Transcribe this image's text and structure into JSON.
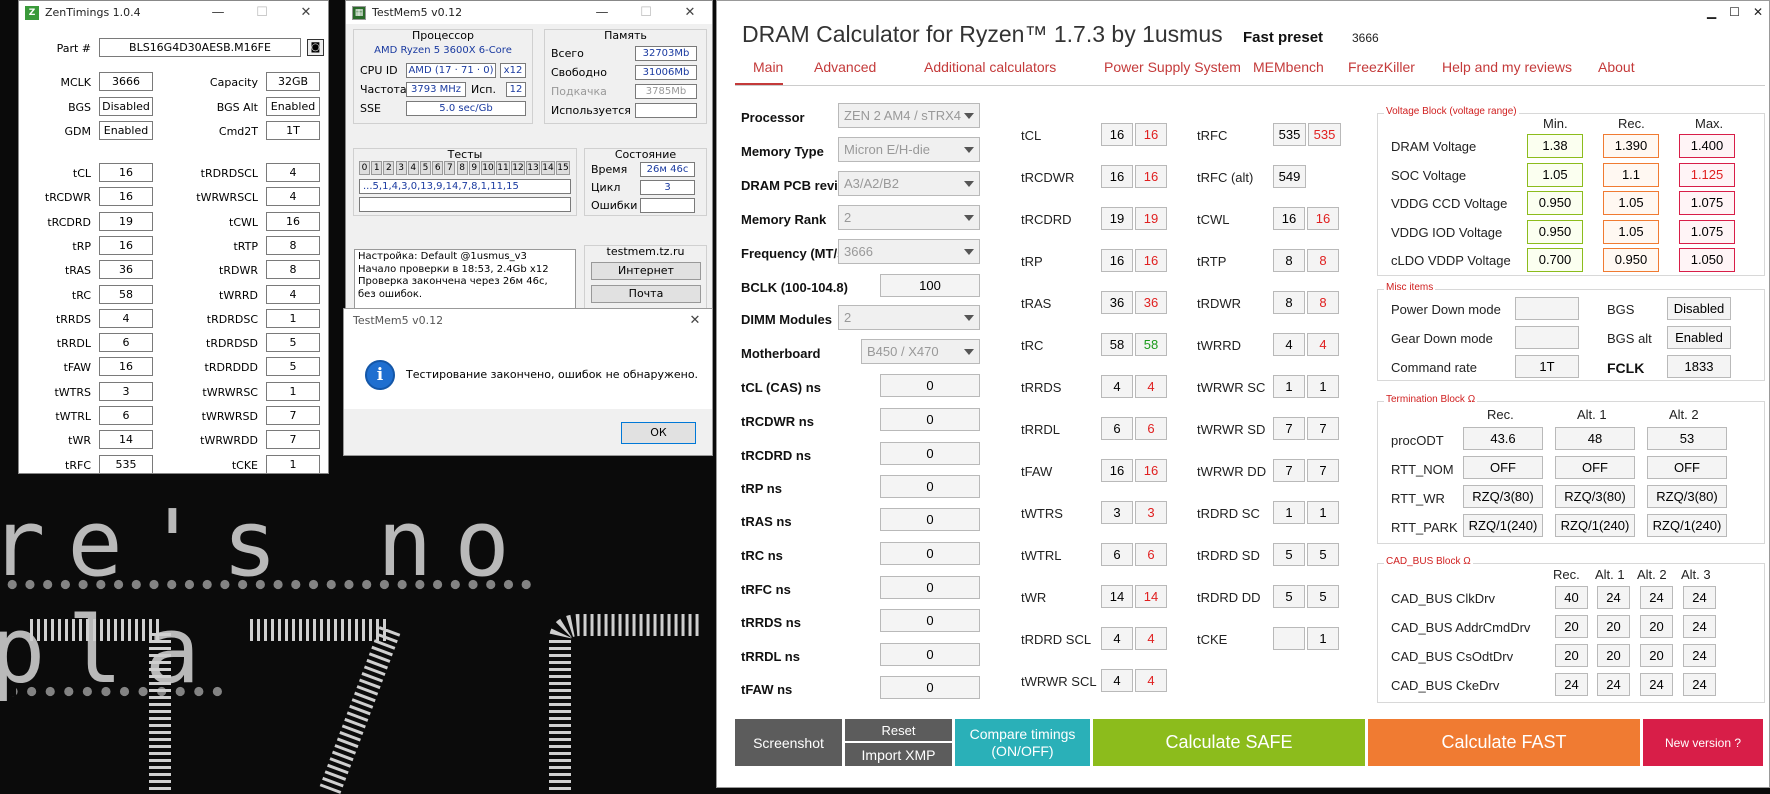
{
  "zen": {
    "title": "ZenTimings 1.0.4",
    "part_label": "Part #",
    "part_value": "BLS16G4D30AESB.M16FE",
    "rows": [
      {
        "l1": "MCLK",
        "v1": "3666",
        "l2": "Capacity",
        "v2": "32GB"
      },
      {
        "l1": "BGS",
        "v1": "Disabled",
        "l2": "BGS Alt",
        "v2": "Enabled"
      },
      {
        "l1": "GDM",
        "v1": "Enabled",
        "l2": "Cmd2T",
        "v2": "1T"
      },
      {
        "l1": "tCL",
        "v1": "16",
        "l2": "tRDRDSCL",
        "v2": "4"
      },
      {
        "l1": "tRCDWR",
        "v1": "16",
        "l2": "tWRWRSCL",
        "v2": "4"
      },
      {
        "l1": "tRCDRD",
        "v1": "19",
        "l2": "tCWL",
        "v2": "16"
      },
      {
        "l1": "tRP",
        "v1": "16",
        "l2": "tRTP",
        "v2": "8"
      },
      {
        "l1": "tRAS",
        "v1": "36",
        "l2": "tRDWR",
        "v2": "8"
      },
      {
        "l1": "tRC",
        "v1": "58",
        "l2": "tWRRD",
        "v2": "4"
      },
      {
        "l1": "tRRDS",
        "v1": "4",
        "l2": "tRDRDSC",
        "v2": "1"
      },
      {
        "l1": "tRRDL",
        "v1": "6",
        "l2": "tRDRDSD",
        "v2": "5"
      },
      {
        "l1": "tFAW",
        "v1": "16",
        "l2": "tRDRDDD",
        "v2": "5"
      },
      {
        "l1": "tWTRS",
        "v1": "3",
        "l2": "tWRWRSC",
        "v2": "1"
      },
      {
        "l1": "tWTRL",
        "v1": "6",
        "l2": "tWRWRSD",
        "v2": "7"
      },
      {
        "l1": "tWR",
        "v1": "14",
        "l2": "tWRWRDD",
        "v2": "7"
      },
      {
        "l1": "tRFC",
        "v1": "535",
        "l2": "tCKE",
        "v2": "1"
      }
    ]
  },
  "tm": {
    "title": "TestMem5 v0.12",
    "cpu_group": "Процессор",
    "cpu_name": "AMD Ryzen 5 3600X 6-Core",
    "cpu_id_label": "CPU ID",
    "cpu_id_value": "AMD  (17 · 71 · 0)",
    "cpu_threads": "x12",
    "freq_label": "Частота",
    "freq_value": "3793 MHz",
    "used_label": "Исп.",
    "used_value": "12",
    "sse_label": "SSE",
    "sse_value": "5.0 sec/Gb",
    "mem_group": "Память",
    "total_label": "Всего",
    "total_value": "32703Mb",
    "free_label": "Свободно",
    "free_value": "31006Mb",
    "swap_label": "Подкачка",
    "swap_value": "3785Mb",
    "inuse_label": "Используется",
    "tests_group": "Тесты",
    "test_cells": [
      "0",
      "1",
      "2",
      "3",
      "4",
      "5",
      "6",
      "7",
      "8",
      "9",
      "10",
      "11",
      "12",
      "13",
      "14",
      "15"
    ],
    "test_seq": "...5,1,4,3,0,13,9,14,7,8,1,11,15",
    "state_group": "Состояние",
    "time_label": "Время",
    "time_value": "26м 46с",
    "cycle_label": "Цикл",
    "cycle_value": "3",
    "err_label": "Ошибки",
    "log": [
      "Настройка: Default @1usmus_v3",
      "Начало проверки в 18:53, 2.4Gb x12",
      "Проверка закончена через 26м 46с,",
      "без ошибок."
    ],
    "site": "testmem.tz.ru",
    "btn_internet": "Интернет",
    "btn_mail": "Почта"
  },
  "dialog": {
    "title": "TestMem5 v0.12",
    "message": "Тестирование закончено, ошибок не обнаружено.",
    "ok": "ОК"
  },
  "bg_text": "re's no pla",
  "dc": {
    "title": "DRAM Calculator for Ryzen™ 1.7.3 by 1usmus",
    "preset_label": "Fast preset",
    "preset_value": "3666",
    "tabs": [
      "Main",
      "Advanced",
      "Additional calculators",
      "Power Supply System",
      "MEMbench",
      "FreezKiller",
      "Help and my reviews",
      "About"
    ],
    "left": [
      {
        "label": "Processor",
        "value": "ZEN 2 AM4 / sTRX4",
        "type": "select"
      },
      {
        "label": "Memory Type",
        "value": "Micron E/H-die",
        "type": "select"
      },
      {
        "label": "DRAM PCB revision",
        "value": "A3/A2/B2",
        "type": "select"
      },
      {
        "label": "Memory Rank",
        "value": "2",
        "type": "select"
      },
      {
        "label": "Frequency (MT/s)",
        "value": "3666",
        "type": "select"
      },
      {
        "label": "BCLK (100-104.8)",
        "value": "100",
        "type": "input"
      },
      {
        "label": "DIMM Modules",
        "value": "2",
        "type": "select"
      },
      {
        "label": "Motherboard",
        "value": "B450 / X470",
        "type": "select"
      },
      {
        "label": "tCL (CAS) ns",
        "value": "0",
        "type": "input"
      },
      {
        "label": "tRCDWR ns",
        "value": "0",
        "type": "input"
      },
      {
        "label": "tRCDRD ns",
        "value": "0",
        "type": "input"
      },
      {
        "label": "tRP ns",
        "value": "0",
        "type": "input"
      },
      {
        "label": "tRAS ns",
        "value": "0",
        "type": "input"
      },
      {
        "label": "tRC ns",
        "value": "0",
        "type": "input"
      },
      {
        "label": "tRFC ns",
        "value": "0",
        "type": "input"
      },
      {
        "label": "tRRDS ns",
        "value": "0",
        "type": "input"
      },
      {
        "label": "tRRDL ns",
        "value": "0",
        "type": "input"
      },
      {
        "label": "tFAW ns",
        "value": "0",
        "type": "input"
      }
    ],
    "mid": [
      {
        "l": "tCL",
        "a": "16",
        "b": "16",
        "c": "red"
      },
      {
        "l": "tRCDWR",
        "a": "16",
        "b": "16",
        "c": "red"
      },
      {
        "l": "tRCDRD",
        "a": "19",
        "b": "19",
        "c": "red"
      },
      {
        "l": "tRP",
        "a": "16",
        "b": "16",
        "c": "red"
      },
      {
        "l": "tRAS",
        "a": "36",
        "b": "36",
        "c": "red"
      },
      {
        "l": "tRC",
        "a": "58",
        "b": "58",
        "c": "green"
      },
      {
        "l": "tRRDS",
        "a": "4",
        "b": "4",
        "c": "red"
      },
      {
        "l": "tRRDL",
        "a": "6",
        "b": "6",
        "c": "red"
      },
      {
        "l": "tFAW",
        "a": "16",
        "b": "16",
        "c": "red"
      },
      {
        "l": "tWTRS",
        "a": "3",
        "b": "3",
        "c": "red"
      },
      {
        "l": "tWTRL",
        "a": "6",
        "b": "6",
        "c": "red"
      },
      {
        "l": "tWR",
        "a": "14",
        "b": "14",
        "c": "red"
      },
      {
        "l": "tRDRD SCL",
        "a": "4",
        "b": "4",
        "c": "red"
      },
      {
        "l": "tWRWR SCL",
        "a": "4",
        "b": "4",
        "c": "red"
      }
    ],
    "right": [
      {
        "l": "tRFC",
        "a": "535",
        "b": "535",
        "c": "red"
      },
      {
        "l": "tRFC (alt)",
        "a": "549",
        "b": "",
        "c": ""
      },
      {
        "l": "tCWL",
        "a": "16",
        "b": "16",
        "c": "red"
      },
      {
        "l": "tRTP",
        "a": "8",
        "b": "8",
        "c": "red"
      },
      {
        "l": "tRDWR",
        "a": "8",
        "b": "8",
        "c": "red"
      },
      {
        "l": "tWRRD",
        "a": "4",
        "b": "4",
        "c": "red"
      },
      {
        "l": "tWRWR SC",
        "a": "1",
        "b": "1",
        "c": ""
      },
      {
        "l": "tWRWR SD",
        "a": "7",
        "b": "7",
        "c": ""
      },
      {
        "l": "tWRWR DD",
        "a": "7",
        "b": "7",
        "c": ""
      },
      {
        "l": "tRDRD SC",
        "a": "1",
        "b": "1",
        "c": ""
      },
      {
        "l": "tRDRD SD",
        "a": "5",
        "b": "5",
        "c": ""
      },
      {
        "l": "tRDRD DD",
        "a": "5",
        "b": "5",
        "c": ""
      },
      {
        "l": "tCKE",
        "a": "",
        "b": "1",
        "c": ""
      }
    ],
    "volt": {
      "title": "Voltage Block (voltage range)",
      "h_min": "Min.",
      "h_rec": "Rec.",
      "h_max": "Max.",
      "rows": [
        {
          "l": "DRAM Voltage",
          "min": "1.38",
          "rec": "1.390",
          "max": "1.400"
        },
        {
          "l": "SOC Voltage",
          "min": "1.05",
          "rec": "1.1",
          "max": "1.125"
        },
        {
          "l": "VDDG  CCD Voltage",
          "min": "0.950",
          "rec": "1.05",
          "max": "1.075"
        },
        {
          "l": "VDDG  IOD Voltage",
          "min": "0.950",
          "rec": "1.05",
          "max": "1.075"
        },
        {
          "l": "cLDO VDDP Voltage",
          "min": "0.700",
          "rec": "0.950",
          "max": "1.050"
        }
      ]
    },
    "misc": {
      "title": "Misc items",
      "pdm": "Power Down mode",
      "gdm": "Gear Down mode",
      "cr": "Command rate",
      "cr_value": "1T",
      "bgs": "BGS",
      "bgs_value": "Disabled",
      "bgsalt": "BGS alt",
      "bgsalt_value": "Enabled",
      "fclk": "FCLK",
      "fclk_value": "1833"
    },
    "term": {
      "title": "Termination Block Ω",
      "h1": "Rec.",
      "h2": "Alt. 1",
      "h3": "Alt. 2",
      "rows": [
        {
          "l": "procODT",
          "v": [
            "43.6",
            "48",
            "53"
          ]
        },
        {
          "l": "RTT_NOM",
          "v": [
            "OFF",
            "OFF",
            "OFF"
          ]
        },
        {
          "l": "RTT_WR",
          "v": [
            "RZQ/3(80)",
            "RZQ/3(80)",
            "RZQ/3(80)"
          ]
        },
        {
          "l": "RTT_PARK",
          "v": [
            "RZQ/1(240)",
            "RZQ/1(240)",
            "RZQ/1(240)"
          ]
        }
      ]
    },
    "cad": {
      "title": "CAD_BUS Block Ω",
      "h": [
        "Rec.",
        "Alt. 1",
        "Alt. 2",
        "Alt. 3"
      ],
      "rows": [
        {
          "l": "CAD_BUS ClkDrv",
          "v": [
            "40",
            "24",
            "24",
            "24"
          ]
        },
        {
          "l": "CAD_BUS AddrCmdDrv",
          "v": [
            "20",
            "20",
            "20",
            "24"
          ]
        },
        {
          "l": "CAD_BUS CsOdtDrv",
          "v": [
            "20",
            "20",
            "20",
            "24"
          ]
        },
        {
          "l": "CAD_BUS CkeDrv",
          "v": [
            "24",
            "24",
            "24",
            "24"
          ]
        }
      ]
    },
    "buttons": {
      "screenshot": "Screenshot",
      "reset": "Reset",
      "import": "Import XMP",
      "compare1": "Compare timings",
      "compare2": "(ON/OFF)",
      "safe": "Calculate SAFE",
      "fast": "Calculate FAST",
      "newver": "New version ?"
    },
    "colors": {
      "accent": "#c43a3a",
      "safe": "#8cbc1c",
      "fast": "#f07b32",
      "compare": "#2ab0b8",
      "newver": "#d81e48",
      "screenshot": "#5c5c5c"
    }
  }
}
